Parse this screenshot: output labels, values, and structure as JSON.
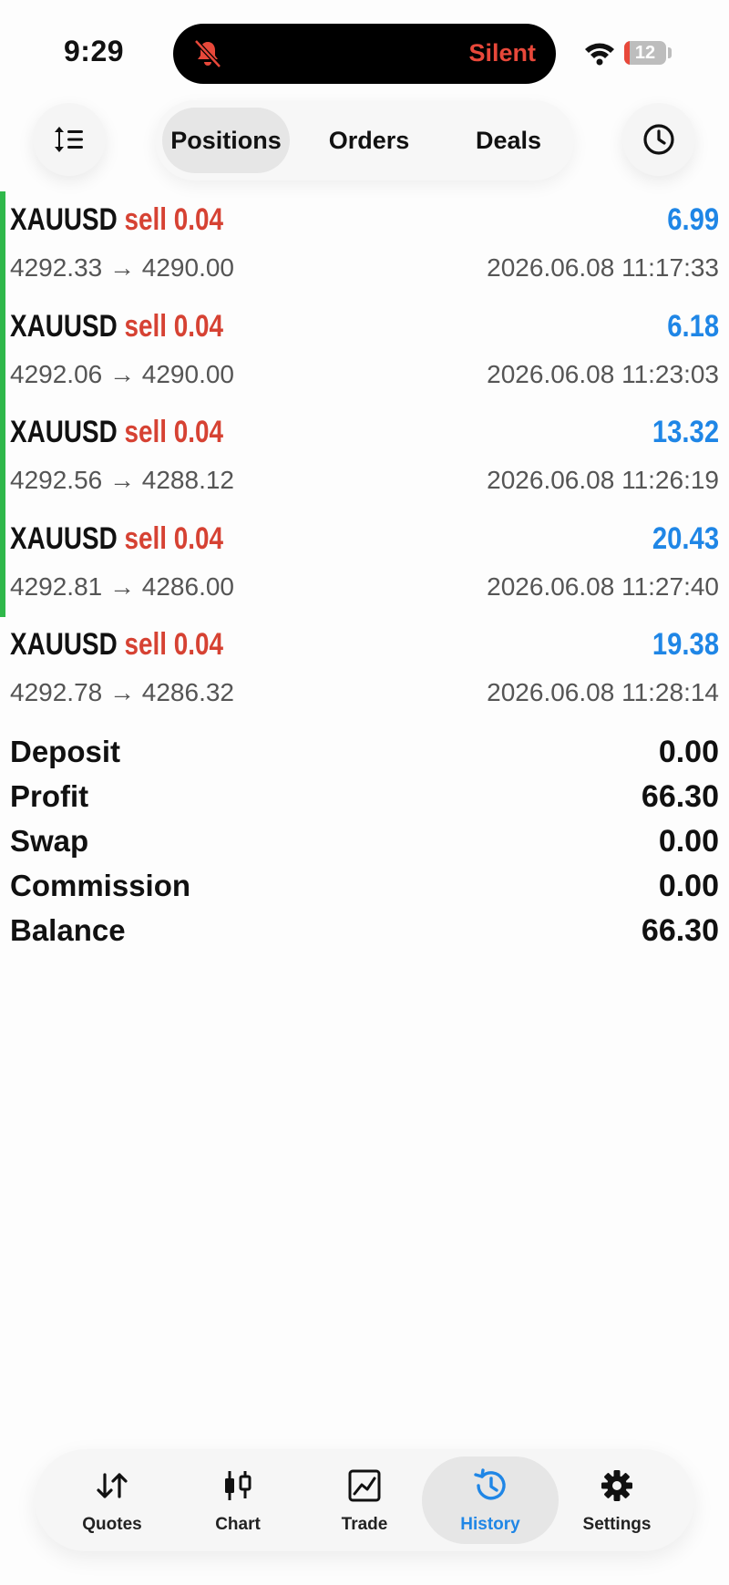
{
  "status_bar": {
    "time": "9:29",
    "focus_mode": "Silent",
    "battery_level": "12",
    "battery_fraction": 0.12
  },
  "colors": {
    "sell": "#d64233",
    "profit_positive": "#1f86e6",
    "active_tab": "#1f86e6",
    "deal_marker": "#2fb84a",
    "silent": "#e8483a"
  },
  "segments": [
    {
      "label": "Positions",
      "active": true
    },
    {
      "label": "Orders",
      "active": false
    },
    {
      "label": "Deals",
      "active": false
    }
  ],
  "toolbar": {
    "sort_icon": "sort-icon",
    "clock_icon": "clock-icon"
  },
  "deals": [
    {
      "symbol": "XAUUSD",
      "side": "sell 0.04",
      "profit": "6.99",
      "open_price": "4292.33",
      "arrow": "→",
      "close_price": "4290.00",
      "time": "2026.06.08 11:17:33"
    },
    {
      "symbol": "XAUUSD",
      "side": "sell 0.04",
      "profit": "6.18",
      "open_price": "4292.06",
      "arrow": "→",
      "close_price": "4290.00",
      "time": "2026.06.08 11:23:03"
    },
    {
      "symbol": "XAUUSD",
      "side": "sell 0.04",
      "profit": "13.32",
      "open_price": "4292.56",
      "arrow": "→",
      "close_price": "4288.12",
      "time": "2026.06.08 11:26:19"
    },
    {
      "symbol": "XAUUSD",
      "side": "sell 0.04",
      "profit": "20.43",
      "open_price": "4292.81",
      "arrow": "→",
      "close_price": "4286.00",
      "time": "2026.06.08 11:27:40"
    },
    {
      "symbol": "XAUUSD",
      "side": "sell 0.04",
      "profit": "19.38",
      "open_price": "4292.78",
      "arrow": "→",
      "close_price": "4286.32",
      "time": "2026.06.08 11:28:14"
    }
  ],
  "summary": [
    {
      "label": "Deposit",
      "value": "0.00"
    },
    {
      "label": "Profit",
      "value": "66.30"
    },
    {
      "label": "Swap",
      "value": "0.00"
    },
    {
      "label": "Commission",
      "value": "0.00"
    },
    {
      "label": "Balance",
      "value": "66.30"
    }
  ],
  "tabs": [
    {
      "label": "Quotes",
      "icon": "quotes-icon",
      "active": false
    },
    {
      "label": "Chart",
      "icon": "candlestick-icon",
      "active": false
    },
    {
      "label": "Trade",
      "icon": "trade-chart-icon",
      "active": false
    },
    {
      "label": "History",
      "icon": "history-icon",
      "active": true
    },
    {
      "label": "Settings",
      "icon": "gear-icon",
      "active": false
    }
  ]
}
